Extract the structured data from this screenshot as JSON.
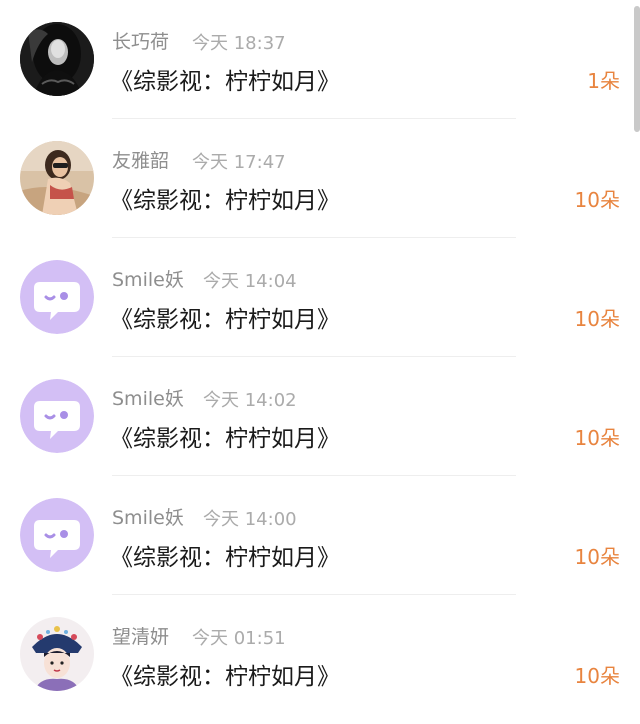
{
  "theme": {
    "accent": "#e8843f",
    "placeholder_avatar_bg": "#d3bff5"
  },
  "items": [
    {
      "name": "长巧荷",
      "time": "今天 18:37",
      "title": "《综影视：柠柠如月》",
      "gift": "1朵",
      "avatar": "photo-dark-hair"
    },
    {
      "name": "友雅韶",
      "time": "今天 17:47",
      "title": "《综影视：柠柠如月》",
      "gift": "10朵",
      "avatar": "photo-sunglasses"
    },
    {
      "name": "Smile妖",
      "time": "今天 14:04",
      "title": "《综影视：柠柠如月》",
      "gift": "10朵",
      "avatar": "default-chat-bubble"
    },
    {
      "name": "Smile妖",
      "time": "今天 14:02",
      "title": "《综影视：柠柠如月》",
      "gift": "10朵",
      "avatar": "default-chat-bubble"
    },
    {
      "name": "Smile妖",
      "time": "今天 14:00",
      "title": "《综影视：柠柠如月》",
      "gift": "10朵",
      "avatar": "default-chat-bubble"
    },
    {
      "name": "望清妍",
      "time": "今天 01:51",
      "title": "《综影视：柠柠如月》",
      "gift": "10朵",
      "avatar": "illustration-qing-lady"
    }
  ]
}
